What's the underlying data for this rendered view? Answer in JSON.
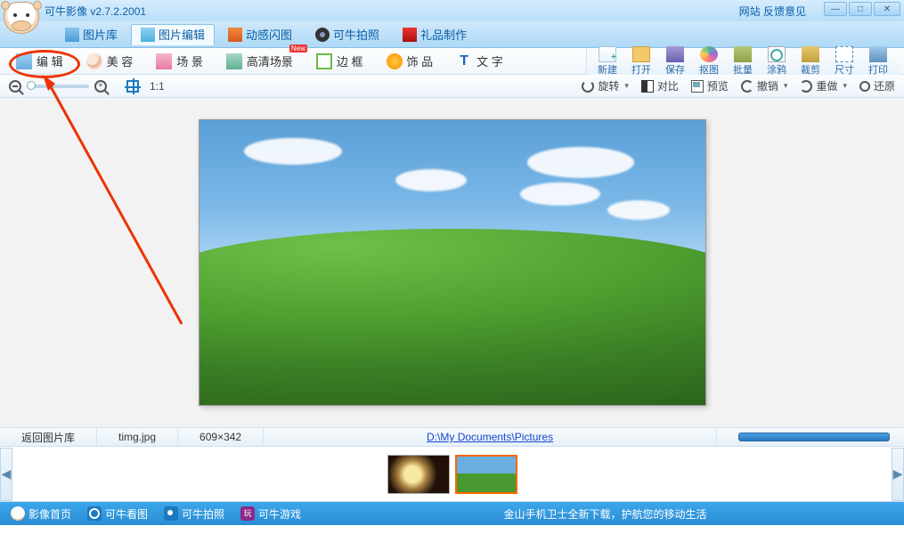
{
  "title": "可牛影像  v2.7.2.2001",
  "top_links": {
    "site": "网站",
    "feedback": "反馈意见"
  },
  "primary_tabs": {
    "library": "图片库",
    "edit": "图片编辑",
    "flash": "动感闪图",
    "camera": "可牛拍照",
    "gift": "礼品制作"
  },
  "tool_tabs": {
    "edit": "编 辑",
    "beauty": "美 容",
    "scene": "场 景",
    "hd": "高清场景",
    "border": "边 框",
    "deco": "饰 品",
    "text": "文 字",
    "new_badge": "New"
  },
  "actions": {
    "new": "新建",
    "open": "打开",
    "save": "保存",
    "crop_sel": "抠图",
    "batch": "批量",
    "doodle": "涂鸦",
    "cut": "裁剪",
    "size": "尺寸",
    "print": "打印"
  },
  "viewbar": {
    "ratio": "1:1",
    "rotate": "旋转",
    "contrast": "对比",
    "preview": "预览",
    "undo": "撤销",
    "redo": "重做",
    "revert": "还原"
  },
  "status": {
    "back": "返回图片库",
    "filename": "timg.jpg",
    "dims": "609×342",
    "path": "D:\\My Documents\\Pictures"
  },
  "bottom": {
    "home": "影像首页",
    "look": "可牛看图",
    "photo": "可牛拍照",
    "game": "可牛游戏",
    "promo": "金山手机卫士全新下载，护航您的移动生活",
    "game_char": "玩"
  }
}
